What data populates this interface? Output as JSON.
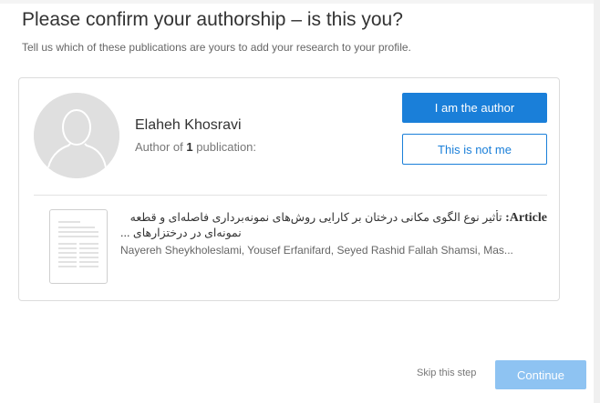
{
  "dialog": {
    "title": "Please confirm your authorship – is this you?",
    "subtitle": "Tell us which of these publications are yours to add your research to your profile."
  },
  "author": {
    "name": "Elaheh Khosravi",
    "meta_prefix": "Author of",
    "publication_count": "1",
    "meta_suffix": "publication:"
  },
  "actions": {
    "author_label": "I am the author",
    "not_me_label": "This is not me",
    "skip_label": "Skip this step",
    "continue_label": "Continue"
  },
  "publication": {
    "type_label": "Article:",
    "title_line1": "تأثیر نوع الگوی مکانی درختان بر کارایی روش‌های نمونه‌برداری فاصله‌ای و قطعه",
    "title_line2": "... نمونه‌ای در درختزارهای",
    "authors": "Nayereh Sheykholeslami, Yousef Erfanifard, Seyed Rashid Fallah Shamsi, Mas..."
  },
  "colors": {
    "primary": "#1a7fd9",
    "continue_disabled": "#8ec3f2"
  },
  "icons": {
    "avatar": "user-silhouette-icon",
    "thumbnail": "document-thumbnail-icon"
  }
}
